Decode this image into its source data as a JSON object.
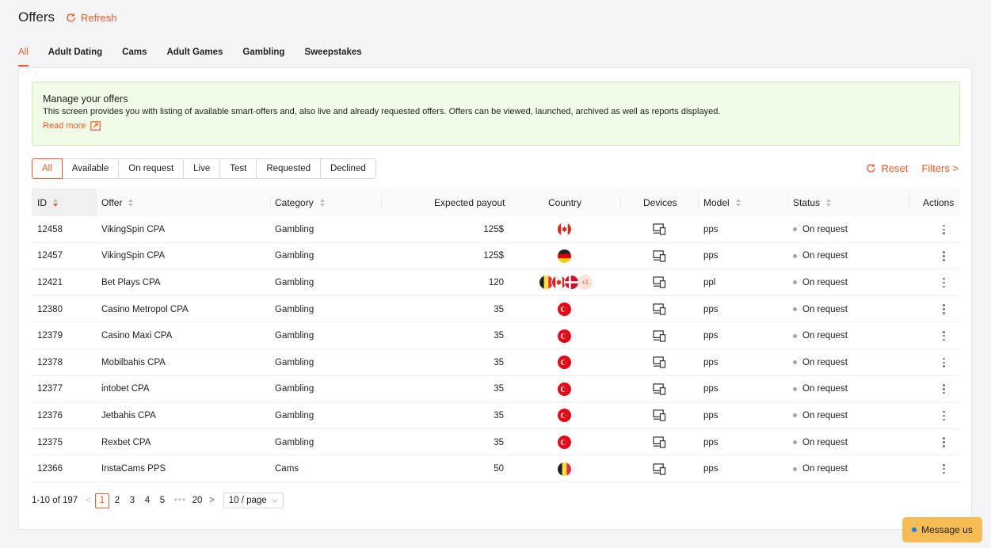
{
  "header": {
    "title": "Offers",
    "refresh_label": "Refresh"
  },
  "category_tabs": [
    {
      "label": "All",
      "active": true
    },
    {
      "label": "Adult Dating"
    },
    {
      "label": "Cams"
    },
    {
      "label": "Adult Games"
    },
    {
      "label": "Gambling"
    },
    {
      "label": "Sweepstakes"
    }
  ],
  "notice": {
    "title": "Manage your offers",
    "text": "This screen provides you with listing of available smart-offers and, also live and already requested offers. Offers can be viewed, launched, archived as well as reports displayed.",
    "link": "Read more"
  },
  "status_filters": [
    {
      "label": "All",
      "active": true
    },
    {
      "label": "Available"
    },
    {
      "label": "On request"
    },
    {
      "label": "Live"
    },
    {
      "label": "Test"
    },
    {
      "label": "Requested"
    },
    {
      "label": "Declined"
    }
  ],
  "actions": {
    "reset": "Reset",
    "filters": "Filters >"
  },
  "table": {
    "columns": {
      "id": "ID",
      "offer": "Offer",
      "category": "Category",
      "payout": "Expected payout",
      "country": "Country",
      "devices": "Devices",
      "model": "Model",
      "status": "Status",
      "actions": "Actions"
    },
    "rows": [
      {
        "id": "12458",
        "offer": "VikingSpin CPA",
        "category": "Gambling",
        "payout": "125$",
        "flags": [
          "canada"
        ],
        "more": "",
        "model": "pps",
        "status": "On request"
      },
      {
        "id": "12457",
        "offer": "VikingSpin CPA",
        "category": "Gambling",
        "payout": "125$",
        "flags": [
          "germany"
        ],
        "more": "",
        "model": "pps",
        "status": "On request"
      },
      {
        "id": "12421",
        "offer": "Bet Plays CPA",
        "category": "Gambling",
        "payout": "120",
        "flags": [
          "belgium",
          "canada",
          "denmark"
        ],
        "more": "+1",
        "model": "ppl",
        "status": "On request"
      },
      {
        "id": "12380",
        "offer": "Casino Metropol CPA",
        "category": "Gambling",
        "payout": "35",
        "flags": [
          "turkey"
        ],
        "more": "",
        "model": "pps",
        "status": "On request"
      },
      {
        "id": "12379",
        "offer": "Casino Maxi CPA",
        "category": "Gambling",
        "payout": "35",
        "flags": [
          "turkey"
        ],
        "more": "",
        "model": "pps",
        "status": "On request"
      },
      {
        "id": "12378",
        "offer": "Mobilbahis CPA",
        "category": "Gambling",
        "payout": "35",
        "flags": [
          "turkey"
        ],
        "more": "",
        "model": "pps",
        "status": "On request"
      },
      {
        "id": "12377",
        "offer": "intobet CPA",
        "category": "Gambling",
        "payout": "35",
        "flags": [
          "turkey"
        ],
        "more": "",
        "model": "pps",
        "status": "On request"
      },
      {
        "id": "12376",
        "offer": "Jetbahis CPA",
        "category": "Gambling",
        "payout": "35",
        "flags": [
          "turkey"
        ],
        "more": "",
        "model": "pps",
        "status": "On request"
      },
      {
        "id": "12375",
        "offer": "Rexbet CPA",
        "category": "Gambling",
        "payout": "35",
        "flags": [
          "turkey"
        ],
        "more": "",
        "model": "pps",
        "status": "On request"
      },
      {
        "id": "12366",
        "offer": "InstaCams PPS",
        "category": "Cams",
        "payout": "50",
        "flags": [
          "belgium"
        ],
        "more": "",
        "model": "pps",
        "status": "On request"
      }
    ]
  },
  "pagination": {
    "range": "1-10 of 197",
    "pages": [
      "1",
      "2",
      "3",
      "4",
      "5"
    ],
    "last_page": "20",
    "current": "1",
    "page_size": "10 / page"
  },
  "chat": {
    "label": "Message us"
  },
  "colors": {
    "accent": "#f05a28",
    "notice_bg": "#f0fbe8",
    "chat_bg": "#f7bc54"
  }
}
